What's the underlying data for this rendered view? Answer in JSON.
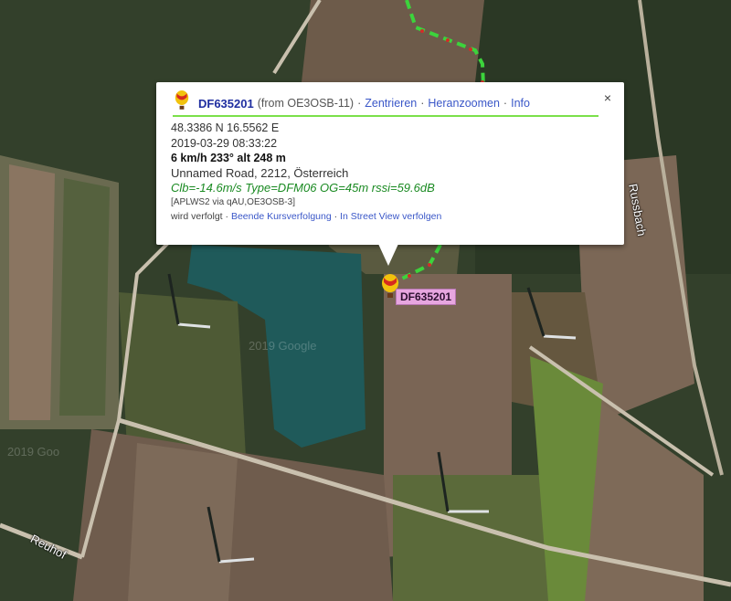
{
  "map": {
    "road_labels": [
      "Russbach",
      "Reuhof"
    ],
    "watermarks": [
      "2019 Google",
      "2019 Goo"
    ],
    "track_color": "#3cd33c",
    "track_dash_color": "#d42a2a"
  },
  "marker": {
    "icon": "balloon-icon",
    "label": "DF635201",
    "label_color": "#e7a6e0"
  },
  "popup": {
    "callsign": "DF635201",
    "from_text": "(from OE3OSB-11)",
    "links": [
      "Zentrieren",
      "Heranzoomen",
      "Info"
    ],
    "link_separator": "·",
    "close_symbol": "×",
    "position": "48.3386 N 16.5562 E",
    "timestamp": "2019-03-29 08:33:22",
    "speed": "6 km/h 233° alt 248 m",
    "address": "Unnamed Road, 2212, Österreich",
    "comment": "Clb=-14.6m/s Type=DFM06 OG=45m rssi=59.6dB",
    "path": "[APLWS2 via qAU,OE3OSB-3]",
    "tracking_status": "wird verfolgt",
    "actions": [
      "Beende Kursverfolgung",
      "In Street View verfolgen"
    ],
    "header_rule_color": "#7be04a"
  }
}
